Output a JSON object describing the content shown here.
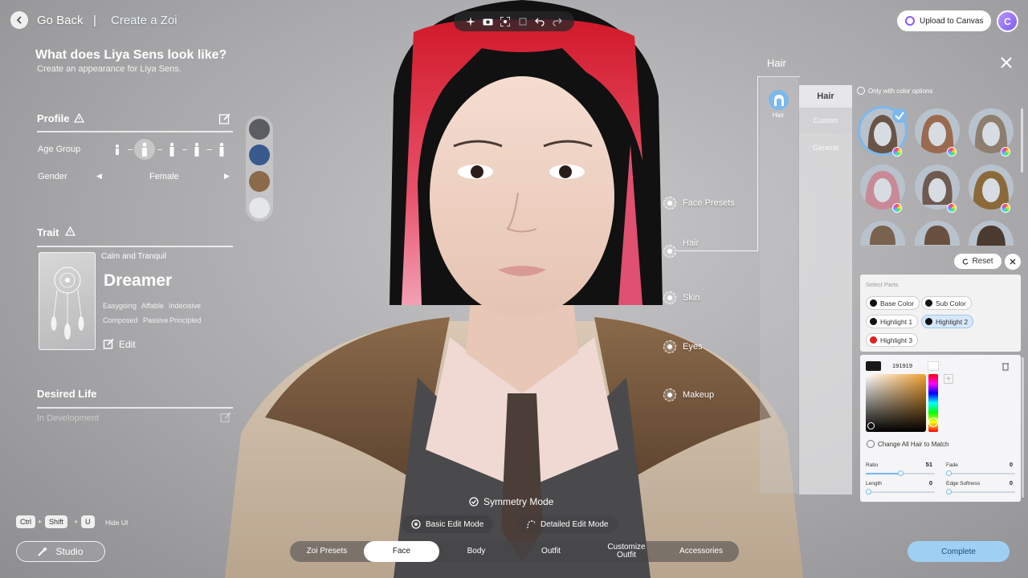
{
  "header": {
    "back_label": "Go Back",
    "separator": "|",
    "page_label": "Create a Zoi",
    "upload_label": "Upload to Canvas",
    "avatar_initial": "C"
  },
  "intro": {
    "title": "What does Liya Sens look like?",
    "subtitle": "Create an appearance for Liya Sens."
  },
  "profile": {
    "heading": "Profile",
    "age_label": "Age Group",
    "gender_label": "Gender",
    "gender_value": "Female"
  },
  "trait": {
    "heading": "Trait",
    "category": "Calm and Tranquil",
    "name": "Dreamer",
    "tags": [
      "Easygoing",
      "Affable",
      "Indecisive",
      "Composed",
      "Passive",
      "Principled"
    ],
    "edit_label": "Edit"
  },
  "desired_life": {
    "heading": "Desired Life",
    "placeholder": "In Development"
  },
  "body_parts": [
    "Face Presets",
    "Hair",
    "Skin",
    "Eyes",
    "Makeup"
  ],
  "hair_panel": {
    "title": "Hair",
    "category_label": "Hair",
    "sub_header": "Hair",
    "sub_items": [
      "Custom",
      "General"
    ],
    "only_color_label": "Only with color options",
    "reset_label": "Reset",
    "select_parts_label": "Select Parts",
    "parts": [
      "Base Color",
      "Sub Color",
      "Highlight 1",
      "Highlight 2",
      "Highlight 3"
    ],
    "hex_value": "191919",
    "change_all_label": "Change All Hair to Match",
    "sliders": {
      "ratio": {
        "label": "Ratio",
        "value": "51"
      },
      "fade": {
        "label": "Fade",
        "value": "0"
      },
      "length": {
        "label": "Length",
        "value": "0"
      },
      "edge": {
        "label": "Edge Softness",
        "value": "0"
      }
    }
  },
  "bottom": {
    "keys": [
      "Ctrl",
      "Shift",
      "U"
    ],
    "plus": "+",
    "hide_ui": "Hide UI",
    "studio_label": "Studio",
    "symmetry_label": "Symmetry Mode",
    "basic_mode": "Basic Edit Mode",
    "detailed_mode": "Detailed Edit Mode",
    "tabs": [
      "Zoi Presets",
      "Face",
      "Body",
      "Outfit",
      "Customize Outfit",
      "Accessories"
    ],
    "complete_label": "Complete"
  },
  "colors": {
    "accent": "#7ab8ee",
    "complete_bg": "#9fd0f3",
    "highlight_3": "#e02020",
    "dark_swatch": "#191919"
  }
}
